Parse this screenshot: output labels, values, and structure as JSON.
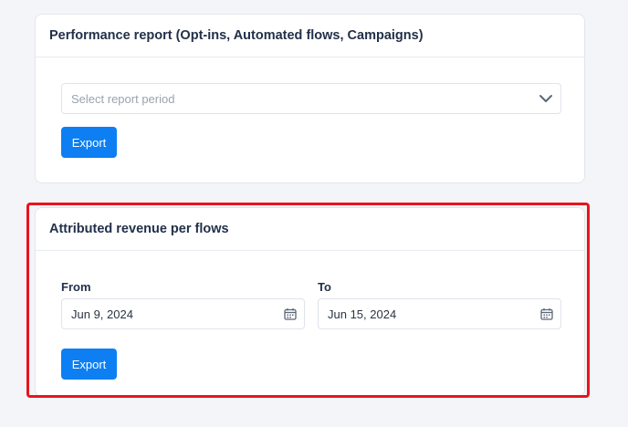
{
  "performance_report": {
    "title": "Performance report (Opt-ins, Automated flows, Campaigns)",
    "period_placeholder": "Select report period",
    "export_label": "Export"
  },
  "attributed_revenue": {
    "title": "Attributed revenue per flows",
    "from_label": "From",
    "from_value": "Jun 9, 2024",
    "to_label": "To",
    "to_value": "Jun 15, 2024",
    "export_label": "Export"
  },
  "icons": {
    "dropdown": "chevron-down-icon",
    "calendar": "calendar-icon"
  },
  "colors": {
    "accent": "#0d7ff2",
    "highlight": "#e8141c",
    "background": "#f4f5f8"
  }
}
